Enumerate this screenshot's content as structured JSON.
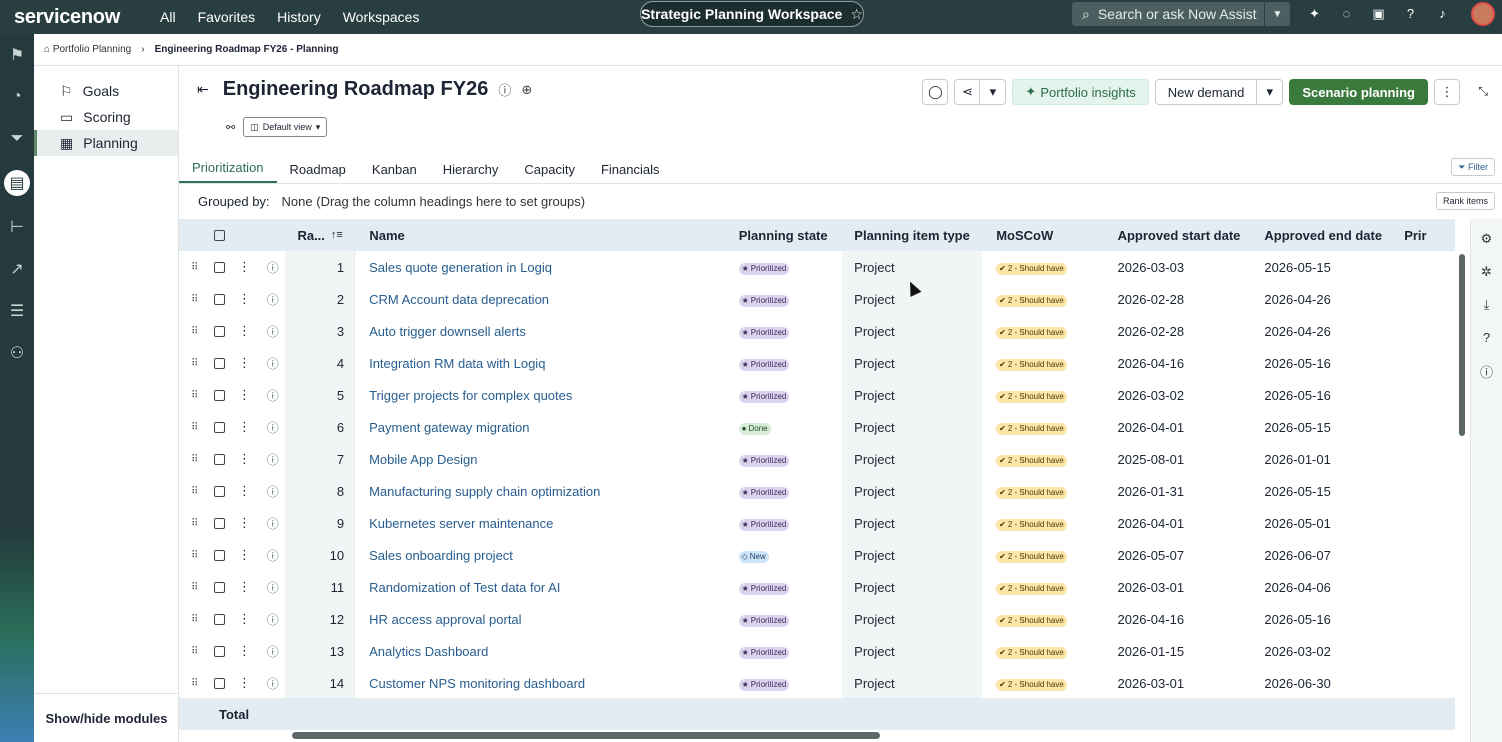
{
  "topbar": {
    "logo": "servicenow",
    "nav": [
      "All",
      "Favorites",
      "History",
      "Workspaces"
    ],
    "workspace": "Strategic Planning Workspace",
    "search_placeholder": "Search or ask Now Assist"
  },
  "breadcrumb": {
    "root": "Portfolio Planning",
    "current": "Engineering Roadmap FY26 - Planning"
  },
  "modules": {
    "items": [
      "Goals",
      "Scoring",
      "Planning"
    ],
    "active": "Planning",
    "footer": "Show/hide modules"
  },
  "header": {
    "title": "Engineering Roadmap FY26",
    "view": "Default view",
    "portfolio_insights": "Portfolio insights",
    "new_demand": "New demand",
    "scenario_planning": "Scenario planning"
  },
  "tabs": [
    "Prioritization",
    "Roadmap",
    "Kanban",
    "Hierarchy",
    "Capacity",
    "Financials"
  ],
  "active_tab": "Prioritization",
  "filter_label": "Filter",
  "grouped_by": {
    "label": "Grouped by:",
    "hint": "None (Drag the column headings here to set groups)"
  },
  "rank_items_label": "Rank items",
  "columns": {
    "rank": "Ra...",
    "name": "Name",
    "state": "Planning state",
    "type": "Planning item type",
    "moscow": "MoSCoW",
    "start": "Approved start date",
    "end": "Approved end date",
    "pri": "Prir"
  },
  "rows": [
    {
      "rank": "1",
      "name": "Sales quote generation in Logiq",
      "state": "Prioritized",
      "type": "Project",
      "moscow": "2 - Should have",
      "start": "2026-03-03",
      "end": "2026-05-15"
    },
    {
      "rank": "2",
      "name": "CRM Account data deprecation",
      "state": "Prioritized",
      "type": "Project",
      "moscow": "2 - Should have",
      "start": "2026-02-28",
      "end": "2026-04-26"
    },
    {
      "rank": "3",
      "name": "Auto trigger downsell alerts",
      "state": "Prioritized",
      "type": "Project",
      "moscow": "2 - Should have",
      "start": "2026-02-28",
      "end": "2026-04-26"
    },
    {
      "rank": "4",
      "name": "Integration RM data with Logiq",
      "state": "Prioritized",
      "type": "Project",
      "moscow": "2 - Should have",
      "start": "2026-04-16",
      "end": "2026-05-16"
    },
    {
      "rank": "5",
      "name": "Trigger projects for complex quotes",
      "state": "Prioritized",
      "type": "Project",
      "moscow": "2 - Should have",
      "start": "2026-03-02",
      "end": "2026-05-16"
    },
    {
      "rank": "6",
      "name": "Payment gateway migration",
      "state": "Done",
      "type": "Project",
      "moscow": "2 - Should have",
      "start": "2026-04-01",
      "end": "2026-05-15"
    },
    {
      "rank": "7",
      "name": "Mobile App Design",
      "state": "Prioritized",
      "type": "Project",
      "moscow": "2 - Should have",
      "start": "2025-08-01",
      "end": "2026-01-01"
    },
    {
      "rank": "8",
      "name": "Manufacturing supply chain optimization",
      "state": "Prioritized",
      "type": "Project",
      "moscow": "2 - Should have",
      "start": "2026-01-31",
      "end": "2026-05-15"
    },
    {
      "rank": "9",
      "name": "Kubernetes server maintenance",
      "state": "Prioritized",
      "type": "Project",
      "moscow": "2 - Should have",
      "start": "2026-04-01",
      "end": "2026-05-01"
    },
    {
      "rank": "10",
      "name": "Sales onboarding project",
      "state": "New",
      "type": "Project",
      "moscow": "2 - Should have",
      "start": "2026-05-07",
      "end": "2026-06-07"
    },
    {
      "rank": "11",
      "name": "Randomization of Test data for AI",
      "state": "Prioritized",
      "type": "Project",
      "moscow": "2 - Should have",
      "start": "2026-03-01",
      "end": "2026-04-06"
    },
    {
      "rank": "12",
      "name": "HR access approval portal",
      "state": "Prioritized",
      "type": "Project",
      "moscow": "2 - Should have",
      "start": "2026-04-16",
      "end": "2026-05-16"
    },
    {
      "rank": "13",
      "name": "Analytics Dashboard",
      "state": "Prioritized",
      "type": "Project",
      "moscow": "2 - Should have",
      "start": "2026-01-15",
      "end": "2026-03-02"
    },
    {
      "rank": "14",
      "name": "Customer NPS monitoring dashboard",
      "state": "Prioritized",
      "type": "Project",
      "moscow": "2 - Should have",
      "start": "2026-03-01",
      "end": "2026-06-30"
    }
  ],
  "total_label": "Total"
}
